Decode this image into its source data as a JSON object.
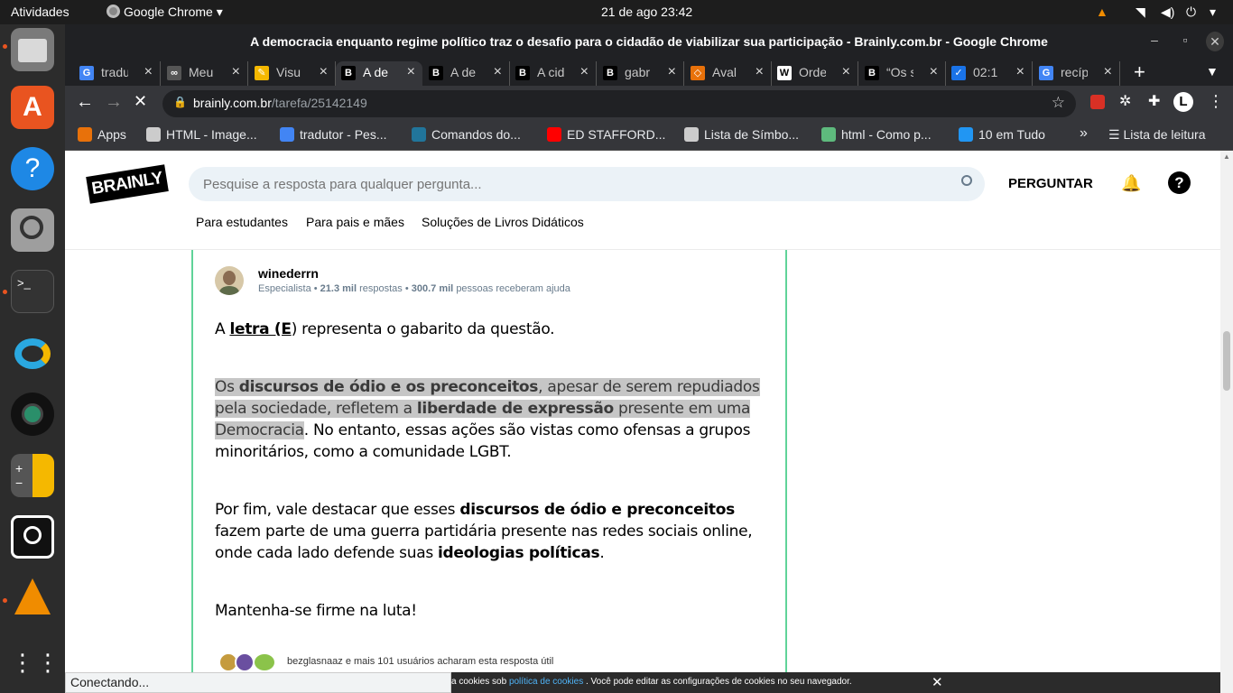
{
  "topbar": {
    "activities": "Atividades",
    "app": "Google Chrome",
    "datetime": "21 de ago  23:42"
  },
  "window": {
    "title": "A democracia enquanto regime político traz o desafio para o cidadão de viabilizar sua participação - Brainly.com.br - Google Chrome"
  },
  "tabs": [
    {
      "icon": "G",
      "label": "tradu"
    },
    {
      "icon": "∞",
      "label": "Meu"
    },
    {
      "icon": "✎",
      "label": "Visu"
    },
    {
      "icon": "B",
      "label": "A de"
    },
    {
      "icon": "B",
      "label": "A de"
    },
    {
      "icon": "B",
      "label": "A cid"
    },
    {
      "icon": "B",
      "label": "gabr"
    },
    {
      "icon": "◇",
      "label": "Aval"
    },
    {
      "icon": "W",
      "label": "Orde"
    },
    {
      "icon": "B",
      "label": "“Os s"
    },
    {
      "icon": "✓",
      "label": "02:1"
    },
    {
      "icon": "G",
      "label": "recíp"
    }
  ],
  "url": {
    "host": "brainly.com.br",
    "path": "/tarefa/25142149"
  },
  "bookmarks": [
    {
      "label": "Apps",
      "color": "#e8710a"
    },
    {
      "label": "HTML - Image...",
      "color": "#cccccc"
    },
    {
      "label": "tradutor - Pes...",
      "color": "#4285f4"
    },
    {
      "label": "Comandos do...",
      "color": "#21759b"
    },
    {
      "label": "ED STAFFORD...",
      "color": "#ff0000"
    },
    {
      "label": "Lista de Símbo...",
      "color": "#cccccc"
    },
    {
      "label": "html - Como p...",
      "color": "#5eba7d"
    },
    {
      "label": "10 em Tudo",
      "color": "#2196f3"
    }
  ],
  "reading_list": "Lista de leitura",
  "brainly": {
    "logo": "BRAINLY",
    "search_placeholder": "Pesquise a resposta para qualquer pergunta...",
    "ask": "PERGUNTAR",
    "nav": [
      "Para estudantes",
      "Para pais e mães",
      "Soluções de Livros Didáticos"
    ]
  },
  "answer": {
    "author": "winederrn",
    "rank": "Especialista",
    "answers_count": "21.3 mil",
    "answers_text": "respostas",
    "helped_count": "300.7 mil",
    "helped_text": "pessoas receberam ajuda",
    "p1": {
      "a": "A ",
      "b": "letra (E",
      "c": ") representa o gabarito da questão."
    },
    "p2": {
      "a": "Os ",
      "b": "discursos de ódio e os preconceitos",
      "c": ", apesar de serem repudiados pela sociedade, refletem a ",
      "d": "liberdade de expressão",
      "e": " presente em uma Democracia",
      "f": ". No entanto, essas ações são vistas como ofensas a grupos minoritários, como a comunidade LGBT."
    },
    "p3": {
      "a": "Por fim, vale destacar que esses ",
      "b": "discursos de ódio e preconceitos",
      "c": " fazem parte de uma guerra partidária presente nas redes sociais online, onde cada lado defende suas ",
      "d": "ideologias políticas",
      "e": "."
    },
    "p4": "Mantenha-se firme na luta!",
    "thanks": "bezglasnaaz e mais 101 usuários acharam esta resposta útil"
  },
  "status": "Conectando...",
  "cookie": {
    "a": "a cookies sob ",
    "link": "política de cookies",
    "b": " . Você pode editar as configurações de cookies no seu navegador."
  }
}
